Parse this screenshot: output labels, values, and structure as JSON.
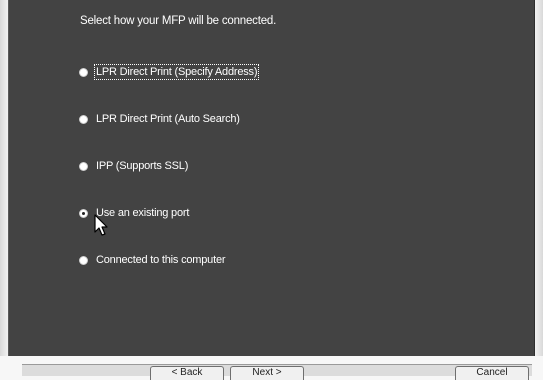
{
  "panel": {
    "instruction": "Select how your MFP will be connected."
  },
  "options": [
    {
      "label": "LPR Direct Print (Specify Address)",
      "checked": false,
      "focused": true
    },
    {
      "label": "LPR Direct Print (Auto Search)",
      "checked": false,
      "focused": false
    },
    {
      "label": "IPP (Supports SSL)",
      "checked": false,
      "focused": false
    },
    {
      "label": "Use an existing port",
      "checked": true,
      "focused": false
    },
    {
      "label": "Connected to this computer",
      "checked": false,
      "focused": false
    }
  ],
  "buttons": {
    "back": "< Back",
    "next": "Next >",
    "cancel": "Cancel"
  },
  "icons": {
    "cursor": "mouse-pointer-icon"
  },
  "colors": {
    "panel_background": "#434343",
    "text": "#ffffff"
  }
}
